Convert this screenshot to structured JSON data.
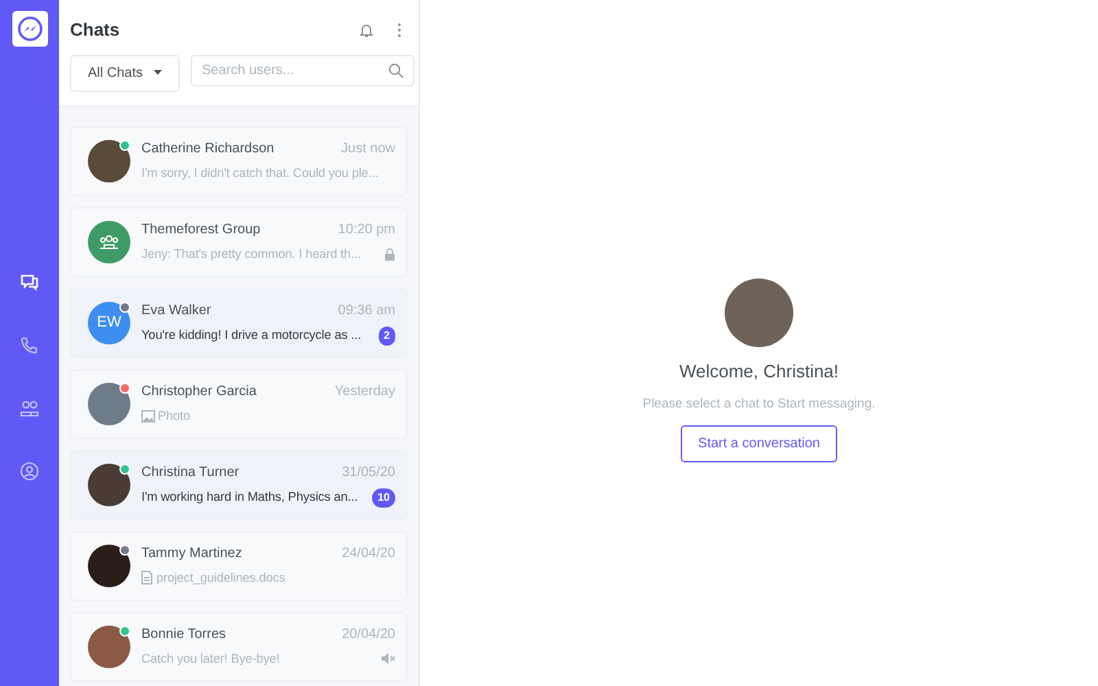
{
  "nav": [
    {
      "kind": "chats",
      "selected": true
    },
    {
      "kind": "calls",
      "selected": false
    },
    {
      "kind": "contacts",
      "selected": false
    },
    {
      "kind": "profile",
      "selected": false
    }
  ],
  "panel": {
    "title": "Chats",
    "filter": "All Chats",
    "search": {
      "placeholder": "Search users..."
    }
  },
  "chats": [
    {
      "name": "Catherine Richardson",
      "time": "Just now",
      "preview": {
        "kind": "text",
        "text": "I'm sorry, I didn't catch that. Could you ple..."
      },
      "avatar": {
        "kind": "photo"
      },
      "color": "#34c38f",
      "unread": false
    },
    {
      "name": "Themeforest Group",
      "time": "10:20 pm",
      "preview": {
        "kind": "text",
        "text": "Jeny: That's pretty common. I heard th..."
      },
      "avatar": {
        "kind": "group"
      },
      "unread": false,
      "trailing_icon": {
        "kind": "lock"
      }
    },
    {
      "name": "Eva Walker",
      "time": "09:36 am",
      "preview": {
        "kind": "text",
        "text": "You're kidding! I drive a motorcycle as ..."
      },
      "avatar": {
        "kind": "initials",
        "text": "EW"
      },
      "color": "#74788d",
      "unread": true,
      "badge": "2"
    },
    {
      "name": "Christopher Garcia",
      "time": "Yesterday",
      "preview": {
        "kind": "photo",
        "text": "Photo"
      },
      "avatar": {
        "kind": "photo"
      },
      "color": "#f46a6a",
      "unread": false
    },
    {
      "name": "Christina Turner",
      "time": "31/05/20",
      "preview": {
        "kind": "text",
        "text": "I'm working hard in Maths, Physics an..."
      },
      "avatar": {
        "kind": "photo"
      },
      "color": "#34c38f",
      "unread": true,
      "badge": "10"
    },
    {
      "name": "Tammy Martinez",
      "time": "24/04/20",
      "preview": {
        "kind": "file",
        "text": "project_guidelines.docs"
      },
      "avatar": {
        "kind": "photo"
      },
      "color": "#74788d",
      "unread": false
    },
    {
      "name": "Bonnie Torres",
      "time": "20/04/20",
      "preview": {
        "kind": "text",
        "text": "Catch you later! Bye-bye!"
      },
      "avatar": {
        "kind": "photo"
      },
      "color": "#34c38f",
      "unread": false,
      "trailing_icon": {
        "kind": "mute"
      }
    }
  ],
  "welcome": {
    "title": "Welcome, Christina!",
    "subtitle": "Please select a chat to Start messaging.",
    "button": "Start a conversation"
  }
}
